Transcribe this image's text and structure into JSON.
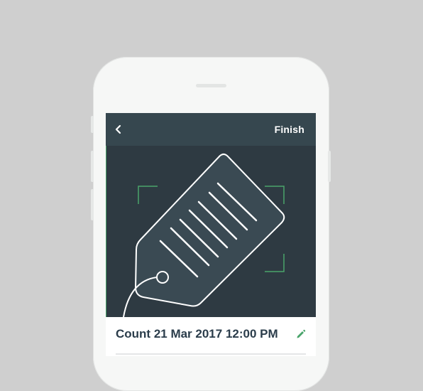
{
  "topbar": {
    "back_icon": "chevron-left-icon",
    "finish_label": "Finish"
  },
  "scan": {
    "illustration": "price-tag-icon",
    "frame_color": "#4aa46b"
  },
  "count": {
    "title": "Count 21 Mar 2017 12:00 PM",
    "edit_icon": "pencil-icon",
    "edit_color": "#4aa46b"
  },
  "colors": {
    "background": "#cfcfcf",
    "phone": "#f6f7f6",
    "topbar": "#36474f",
    "scan_area": "#2e3a42",
    "tag_fill": "#3a4a53",
    "title_text": "#2b3d4b"
  }
}
